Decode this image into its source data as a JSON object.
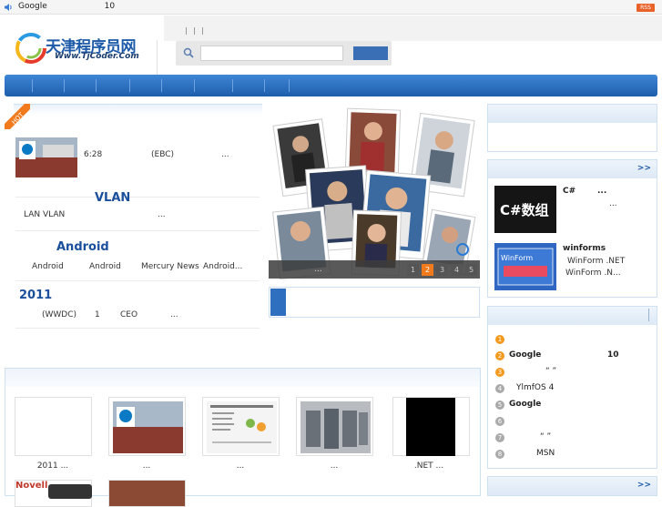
{
  "topbar": {
    "news_prefix": "Google",
    "news_num": "10",
    "rss_label": "RSS"
  },
  "header": {
    "logo_cn": "天津程序员网",
    "logo_en": "Www.TjCoder.Com",
    "search_placeholder": ""
  },
  "hot": {
    "badge": "HOT",
    "articles": [
      {
        "title": "",
        "desc_a": "6:28",
        "desc_b": "(EBC)",
        "desc_c": "..."
      },
      {
        "title": "VLAN",
        "desc_a": "LAN VLAN",
        "desc_b": "..."
      },
      {
        "title": "Android",
        "desc_a": "Android",
        "desc_b": "Android",
        "desc_c": "Mercury News",
        "desc_d": "Android..."
      },
      {
        "title": "2011",
        "desc_a": "(WWDC)",
        "desc_b": "1",
        "desc_c": "CEO",
        "desc_d": "..."
      }
    ]
  },
  "slider": {
    "caption": "...",
    "pages": [
      "1",
      "2",
      "3",
      "4",
      "5"
    ],
    "active_page": 2
  },
  "right": {
    "box2": {
      "more": ">>",
      "items": [
        {
          "title": "C#",
          "title_more": "...",
          "desc": "...",
          "thumb_text": "C#数组"
        },
        {
          "title": "winforms",
          "desc1": "WinForm .NET",
          "desc2": "WinForm .N...",
          "thumb_text": "WinForm"
        }
      ]
    },
    "box3": {
      "more": ">>",
      "ranks": [
        {
          "n": "1",
          "text": "",
          "hot": true
        },
        {
          "n": "2",
          "text": "Google",
          "extra": "10",
          "hot": true
        },
        {
          "n": "3",
          "text": "“ ”",
          "hot": true
        },
        {
          "n": "4",
          "text": "YlmfOS 4",
          "hot": false
        },
        {
          "n": "5",
          "text": "Google",
          "hot": false
        },
        {
          "n": "6",
          "text": "",
          "hot": false
        },
        {
          "n": "7",
          "text": "“ ”",
          "hot": false
        },
        {
          "n": "8",
          "text": "MSN",
          "hot": false
        }
      ]
    },
    "box4": {
      "more": ">>"
    }
  },
  "gallery": {
    "captions": [
      "2011 ...",
      "...",
      "...",
      "...",
      ".NET ..."
    ],
    "second_row_labels": [
      "Novell",
      ""
    ]
  },
  "colors": {
    "brand_blue": "#1d5aa8",
    "nav_top": "#3f86d6",
    "nav_bottom": "#1d5eab",
    "accent_orange": "#f07a1c",
    "rss_orange": "#e8622a"
  }
}
